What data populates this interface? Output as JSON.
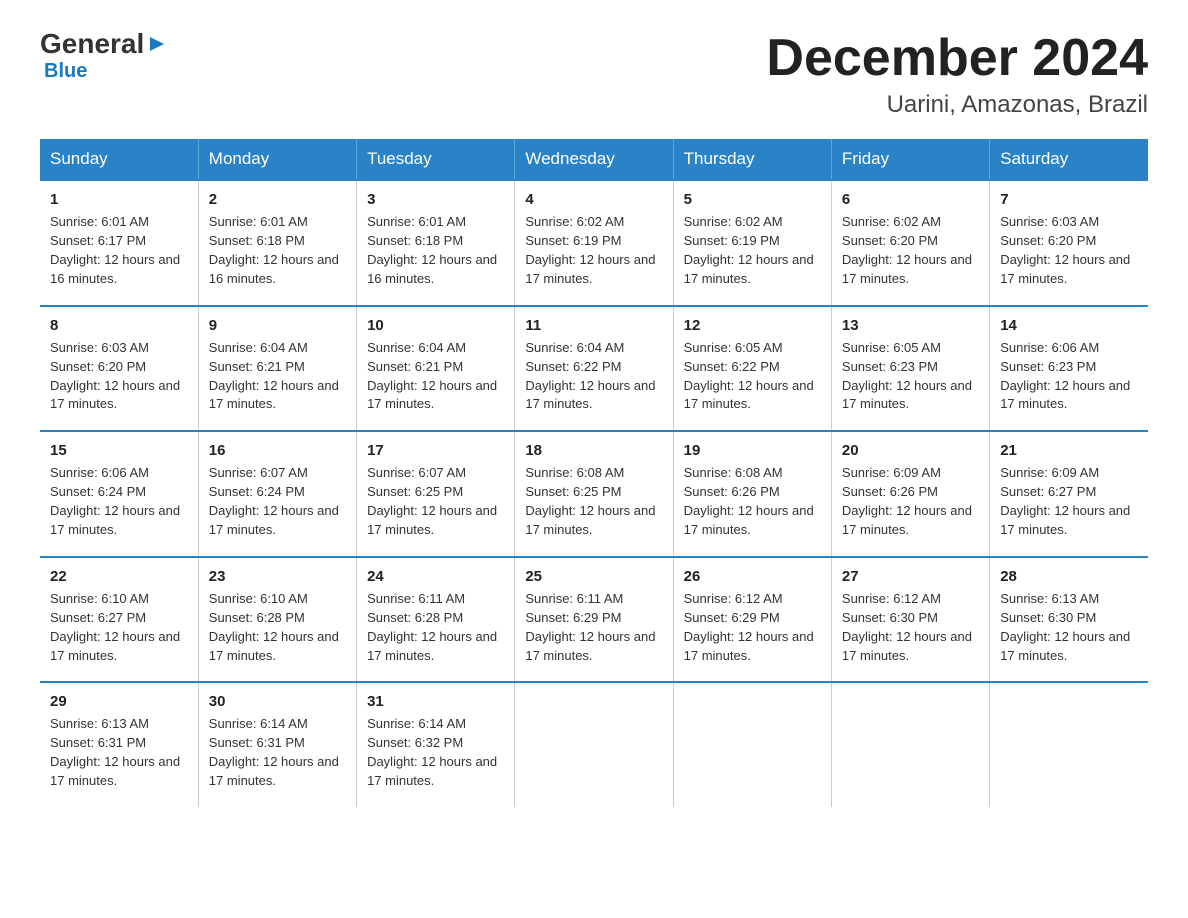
{
  "logo": {
    "general": "General",
    "blue": "Blue",
    "arrow": "▶"
  },
  "title": "December 2024",
  "subtitle": "Uarini, Amazonas, Brazil",
  "days_of_week": [
    "Sunday",
    "Monday",
    "Tuesday",
    "Wednesday",
    "Thursday",
    "Friday",
    "Saturday"
  ],
  "weeks": [
    [
      {
        "day": "1",
        "sunrise": "6:01 AM",
        "sunset": "6:17 PM",
        "daylight": "12 hours and 16 minutes."
      },
      {
        "day": "2",
        "sunrise": "6:01 AM",
        "sunset": "6:18 PM",
        "daylight": "12 hours and 16 minutes."
      },
      {
        "day": "3",
        "sunrise": "6:01 AM",
        "sunset": "6:18 PM",
        "daylight": "12 hours and 16 minutes."
      },
      {
        "day": "4",
        "sunrise": "6:02 AM",
        "sunset": "6:19 PM",
        "daylight": "12 hours and 17 minutes."
      },
      {
        "day": "5",
        "sunrise": "6:02 AM",
        "sunset": "6:19 PM",
        "daylight": "12 hours and 17 minutes."
      },
      {
        "day": "6",
        "sunrise": "6:02 AM",
        "sunset": "6:20 PM",
        "daylight": "12 hours and 17 minutes."
      },
      {
        "day": "7",
        "sunrise": "6:03 AM",
        "sunset": "6:20 PM",
        "daylight": "12 hours and 17 minutes."
      }
    ],
    [
      {
        "day": "8",
        "sunrise": "6:03 AM",
        "sunset": "6:20 PM",
        "daylight": "12 hours and 17 minutes."
      },
      {
        "day": "9",
        "sunrise": "6:04 AM",
        "sunset": "6:21 PM",
        "daylight": "12 hours and 17 minutes."
      },
      {
        "day": "10",
        "sunrise": "6:04 AM",
        "sunset": "6:21 PM",
        "daylight": "12 hours and 17 minutes."
      },
      {
        "day": "11",
        "sunrise": "6:04 AM",
        "sunset": "6:22 PM",
        "daylight": "12 hours and 17 minutes."
      },
      {
        "day": "12",
        "sunrise": "6:05 AM",
        "sunset": "6:22 PM",
        "daylight": "12 hours and 17 minutes."
      },
      {
        "day": "13",
        "sunrise": "6:05 AM",
        "sunset": "6:23 PM",
        "daylight": "12 hours and 17 minutes."
      },
      {
        "day": "14",
        "sunrise": "6:06 AM",
        "sunset": "6:23 PM",
        "daylight": "12 hours and 17 minutes."
      }
    ],
    [
      {
        "day": "15",
        "sunrise": "6:06 AM",
        "sunset": "6:24 PM",
        "daylight": "12 hours and 17 minutes."
      },
      {
        "day": "16",
        "sunrise": "6:07 AM",
        "sunset": "6:24 PM",
        "daylight": "12 hours and 17 minutes."
      },
      {
        "day": "17",
        "sunrise": "6:07 AM",
        "sunset": "6:25 PM",
        "daylight": "12 hours and 17 minutes."
      },
      {
        "day": "18",
        "sunrise": "6:08 AM",
        "sunset": "6:25 PM",
        "daylight": "12 hours and 17 minutes."
      },
      {
        "day": "19",
        "sunrise": "6:08 AM",
        "sunset": "6:26 PM",
        "daylight": "12 hours and 17 minutes."
      },
      {
        "day": "20",
        "sunrise": "6:09 AM",
        "sunset": "6:26 PM",
        "daylight": "12 hours and 17 minutes."
      },
      {
        "day": "21",
        "sunrise": "6:09 AM",
        "sunset": "6:27 PM",
        "daylight": "12 hours and 17 minutes."
      }
    ],
    [
      {
        "day": "22",
        "sunrise": "6:10 AM",
        "sunset": "6:27 PM",
        "daylight": "12 hours and 17 minutes."
      },
      {
        "day": "23",
        "sunrise": "6:10 AM",
        "sunset": "6:28 PM",
        "daylight": "12 hours and 17 minutes."
      },
      {
        "day": "24",
        "sunrise": "6:11 AM",
        "sunset": "6:28 PM",
        "daylight": "12 hours and 17 minutes."
      },
      {
        "day": "25",
        "sunrise": "6:11 AM",
        "sunset": "6:29 PM",
        "daylight": "12 hours and 17 minutes."
      },
      {
        "day": "26",
        "sunrise": "6:12 AM",
        "sunset": "6:29 PM",
        "daylight": "12 hours and 17 minutes."
      },
      {
        "day": "27",
        "sunrise": "6:12 AM",
        "sunset": "6:30 PM",
        "daylight": "12 hours and 17 minutes."
      },
      {
        "day": "28",
        "sunrise": "6:13 AM",
        "sunset": "6:30 PM",
        "daylight": "12 hours and 17 minutes."
      }
    ],
    [
      {
        "day": "29",
        "sunrise": "6:13 AM",
        "sunset": "6:31 PM",
        "daylight": "12 hours and 17 minutes."
      },
      {
        "day": "30",
        "sunrise": "6:14 AM",
        "sunset": "6:31 PM",
        "daylight": "12 hours and 17 minutes."
      },
      {
        "day": "31",
        "sunrise": "6:14 AM",
        "sunset": "6:32 PM",
        "daylight": "12 hours and 17 minutes."
      },
      {
        "day": "",
        "sunrise": "",
        "sunset": "",
        "daylight": ""
      },
      {
        "day": "",
        "sunrise": "",
        "sunset": "",
        "daylight": ""
      },
      {
        "day": "",
        "sunrise": "",
        "sunset": "",
        "daylight": ""
      },
      {
        "day": "",
        "sunrise": "",
        "sunset": "",
        "daylight": ""
      }
    ]
  ]
}
